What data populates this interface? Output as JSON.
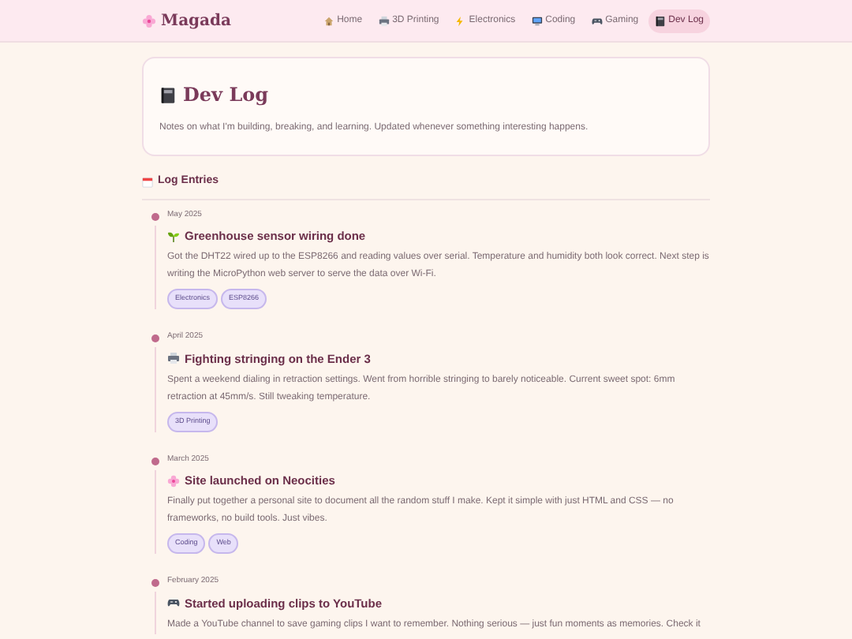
{
  "brand": {
    "name": "Magada"
  },
  "nav": [
    {
      "label": "Home",
      "kind": "home",
      "selected": false
    },
    {
      "label": "3D Printing",
      "kind": "printer",
      "selected": false
    },
    {
      "label": "Electronics",
      "kind": "bolt",
      "selected": false
    },
    {
      "label": "Coding",
      "kind": "monitor",
      "selected": false
    },
    {
      "label": "Gaming",
      "kind": "gamepad",
      "selected": false
    },
    {
      "label": "Dev Log",
      "kind": "book",
      "selected": true
    }
  ],
  "header": {
    "title": "Dev Log",
    "description": "Notes on what I'm building, breaking, and learning. Updated whenever something interesting happens."
  },
  "section": {
    "title": "Log Entries"
  },
  "entries": [
    {
      "date": "May 2025",
      "kind": "sprout",
      "title": "Greenhouse sensor wiring done",
      "body": "Got the DHT22 wired up to the ESP8266 and reading values over serial. Temperature and humidity both look correct. Next step is writing the MicroPython web server to serve the data over Wi-Fi.",
      "tags": [
        "Electronics",
        "ESP8266"
      ]
    },
    {
      "date": "April 2025",
      "kind": "printer",
      "title": "Fighting stringing on the Ender 3",
      "body": "Spent a weekend dialing in retraction settings. Went from horrible stringing to barely noticeable. Current sweet spot: 6mm retraction at 45mm/s. Still tweaking temperature.",
      "tags": [
        "3D Printing"
      ]
    },
    {
      "date": "March 2025",
      "kind": "flower",
      "title": "Site launched on Neocities",
      "body": "Finally put together a personal site to document all the random stuff I make. Kept it simple with just HTML and CSS — no frameworks, no build tools. Just vibes.",
      "tags": [
        "Coding",
        "Web"
      ]
    },
    {
      "date": "February 2025",
      "kind": "gamepad",
      "title": "Started uploading clips to YouTube",
      "body": "Made a YouTube channel to save gaming clips I want to remember. Nothing serious — just fun moments as memories. Check it"
    }
  ]
}
